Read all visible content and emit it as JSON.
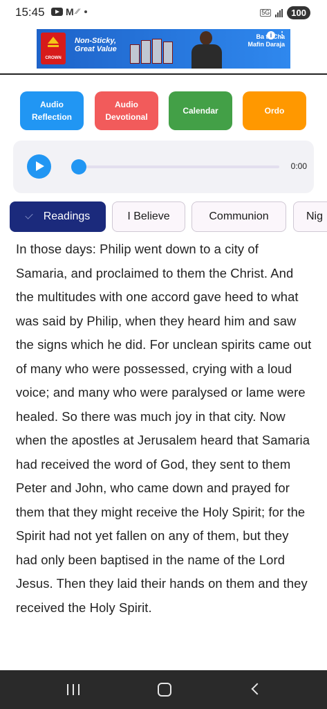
{
  "status_bar": {
    "time": "15:45",
    "battery": "100",
    "network": "5G"
  },
  "ad": {
    "brand": "CROWN",
    "headline": "Non-Sticky, Great Value",
    "tagline": "Ba ta Cha\nMafin Daraja",
    "info_glyph": "i",
    "more_glyph": "⋮",
    "bg_color": "#1e63c9"
  },
  "actions": [
    {
      "label": "Audio\nReflection",
      "color": "#2196f3"
    },
    {
      "label": "Audio\nDevotional",
      "color": "#f25b5b"
    },
    {
      "label": "Calendar",
      "color": "#43a047"
    },
    {
      "label": "Ordo",
      "color": "#ff9800"
    }
  ],
  "player": {
    "time": "0:00",
    "progress": 0,
    "accent": "#2196f3"
  },
  "tabs": [
    {
      "label": "Readings",
      "active": true
    },
    {
      "label": "I Believe",
      "active": false
    },
    {
      "label": "Communion",
      "active": false
    },
    {
      "label": "Nig",
      "active": false
    }
  ],
  "reading": {
    "text": "In those days: Philip went down to a city of Samaria, and proclaimed to them the Christ. And the multitudes with one accord gave heed to what was said by Philip, when they heard him and saw the signs which he did. For unclean spirits came out of many who were possessed, crying with a loud voice; and many who were paralysed or lame were healed. So there was much joy in that city. Now when the apostles at Jerusalem heard that Samaria had received the word of God, they sent to them Peter and John, who came down and prayed for them that they might receive the Holy Spirit; for the Spirit had not yet fallen on any of them, but they had only been baptised in the name of the Lord Jesus. Then they laid their hands on them and they received the Holy Spirit."
  }
}
